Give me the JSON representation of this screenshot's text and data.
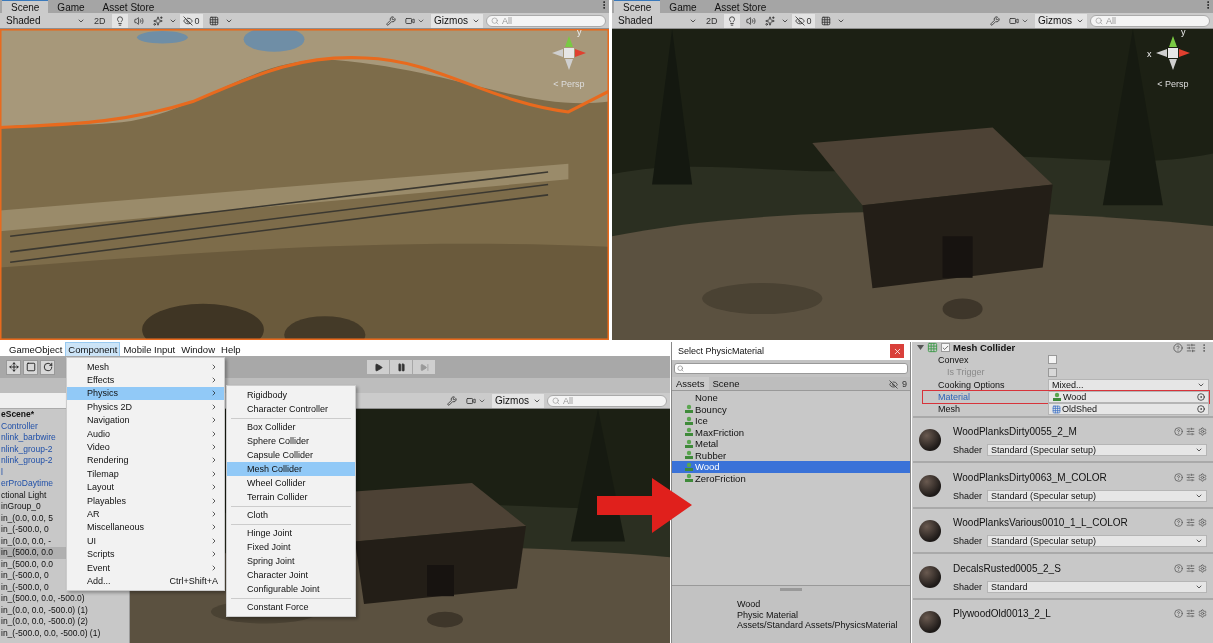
{
  "scene_views": [
    {
      "tabs": [
        {
          "label": "Scene",
          "selected": true
        },
        {
          "label": "Game",
          "selected": false
        },
        {
          "label": "Asset Store",
          "selected": false
        }
      ],
      "shading": "Shaded",
      "mode_2d": "2D",
      "hidden_count": "0",
      "gizmos": "Gizmos",
      "search": {
        "placeholder": "All"
      },
      "persp": "< Persp",
      "axis_labels": [
        "y"
      ]
    },
    {
      "tabs": [
        {
          "label": "Scene",
          "selected": true
        },
        {
          "label": "Game",
          "selected": false
        },
        {
          "label": "Asset Store",
          "selected": false
        }
      ],
      "shading": "Shaded",
      "mode_2d": "2D",
      "hidden_count": "0",
      "gizmos": "Gizmos",
      "search": {
        "placeholder": "All"
      },
      "persp": "< Persp",
      "axis_labels": [
        "y",
        "x"
      ]
    }
  ],
  "editor": {
    "menubar": [
      {
        "label": "GameObject",
        "selected": false
      },
      {
        "label": "Component",
        "selected": true
      },
      {
        "label": "Mobile Input",
        "selected": false
      },
      {
        "label": "Window",
        "selected": false
      },
      {
        "label": "Help",
        "selected": false
      }
    ],
    "play_controls": [
      {
        "kind": "play",
        "disabled": false
      },
      {
        "kind": "pause",
        "disabled": false
      },
      {
        "kind": "step",
        "disabled": true
      }
    ],
    "hierarchy": [
      {
        "label": "eScene*",
        "kind": "scene",
        "selected": false
      },
      {
        "label": "Controller",
        "kind": "prefab",
        "selected": false
      },
      {
        "label": "nlink_barbwire",
        "kind": "prefab",
        "selected": false
      },
      {
        "label": "nlink_group-2",
        "kind": "prefab",
        "selected": false
      },
      {
        "label": "nlink_group-2",
        "kind": "prefab",
        "selected": false
      },
      {
        "label": "l",
        "kind": "prefab",
        "selected": false
      },
      {
        "label": "erProDaytime",
        "kind": "prefab",
        "selected": false
      },
      {
        "label": "ctional Light",
        "kind": "object",
        "selected": false
      },
      {
        "label": "inGroup_0",
        "kind": "object",
        "selected": false
      },
      {
        "label": "in_(0.0, 0.0, 5",
        "kind": "object",
        "selected": false
      },
      {
        "label": "in_(-500.0, 0",
        "kind": "object",
        "selected": false
      },
      {
        "label": "in_(0.0, 0.0, -",
        "kind": "object",
        "selected": false
      },
      {
        "label": "in_(500.0, 0.0",
        "kind": "object",
        "selected": true
      },
      {
        "label": "in_(500.0, 0.0",
        "kind": "object",
        "selected": false
      },
      {
        "label": "in_(-500.0, 0",
        "kind": "object",
        "selected": false
      },
      {
        "label": "in_(-500.0, 0",
        "kind": "object",
        "selected": false
      },
      {
        "label": "in_(500.0, 0.0, -500.0)",
        "kind": "object",
        "selected": false
      },
      {
        "label": "in_(0.0, 0.0, -500.0) (1)",
        "kind": "object",
        "selected": false
      },
      {
        "label": "in_(0.0, 0.0, -500.0) (2)",
        "kind": "object",
        "selected": false
      },
      {
        "label": "in_(-500.0, 0.0, -500.0) (1)",
        "kind": "object",
        "selected": false
      }
    ],
    "scene_toolbar": {
      "gizmos": "Gizmos",
      "search": {
        "placeholder": "All"
      }
    },
    "component_menu": [
      {
        "label": "Mesh",
        "submenu": true,
        "selected": false
      },
      {
        "label": "Effects",
        "submenu": true,
        "selected": false
      },
      {
        "label": "Physics",
        "submenu": true,
        "selected": true
      },
      {
        "label": "Physics 2D",
        "submenu": true,
        "selected": false
      },
      {
        "label": "Navigation",
        "submenu": true,
        "selected": false
      },
      {
        "label": "Audio",
        "submenu": true,
        "selected": false
      },
      {
        "label": "Video",
        "submenu": true,
        "selected": false
      },
      {
        "label": "Rendering",
        "submenu": true,
        "selected": false
      },
      {
        "label": "Tilemap",
        "submenu": true,
        "selected": false
      },
      {
        "label": "Layout",
        "submenu": true,
        "selected": false
      },
      {
        "label": "Playables",
        "submenu": true,
        "selected": false
      },
      {
        "label": "AR",
        "submenu": true,
        "selected": false
      },
      {
        "label": "Miscellaneous",
        "submenu": true,
        "selected": false
      },
      {
        "label": "UI",
        "submenu": true,
        "selected": false
      },
      {
        "label": "Scripts",
        "submenu": true,
        "selected": false
      },
      {
        "label": "Event",
        "submenu": true,
        "selected": false
      },
      {
        "label": "Add...",
        "submenu": false,
        "shortcut": "Ctrl+Shift+A",
        "selected": false
      }
    ],
    "physics_submenu": [
      [
        {
          "label": "Rigidbody",
          "selected": false
        },
        {
          "label": "Character Controller",
          "selected": false
        }
      ],
      [
        {
          "label": "Box Collider",
          "selected": false
        },
        {
          "label": "Sphere Collider",
          "selected": false
        },
        {
          "label": "Capsule Collider",
          "selected": false
        },
        {
          "label": "Mesh Collider",
          "selected": true
        },
        {
          "label": "Wheel Collider",
          "selected": false
        },
        {
          "label": "Terrain Collider",
          "selected": false
        }
      ],
      [
        {
          "label": "Cloth",
          "selected": false
        }
      ],
      [
        {
          "label": "Hinge Joint",
          "selected": false
        },
        {
          "label": "Fixed Joint",
          "selected": false
        },
        {
          "label": "Spring Joint",
          "selected": false
        },
        {
          "label": "Character Joint",
          "selected": false
        },
        {
          "label": "Configurable Joint",
          "selected": false
        }
      ],
      [
        {
          "label": "Constant Force",
          "selected": false
        }
      ]
    ]
  },
  "picker": {
    "title": "Select PhysicMaterial",
    "tabs": [
      {
        "label": "Assets",
        "selected": true
      },
      {
        "label": "Scene",
        "selected": false
      }
    ],
    "hidden_count": "9",
    "items": [
      {
        "label": "None",
        "kind": "none",
        "selected": false
      },
      {
        "label": "Bouncy",
        "kind": "asset",
        "selected": false
      },
      {
        "label": "Ice",
        "kind": "asset",
        "selected": false
      },
      {
        "label": "MaxFriction",
        "kind": "asset",
        "selected": false
      },
      {
        "label": "Metal",
        "kind": "asset",
        "selected": false
      },
      {
        "label": "Rubber",
        "kind": "asset",
        "selected": false
      },
      {
        "label": "Wood",
        "kind": "asset",
        "selected": true
      },
      {
        "label": "ZeroFriction",
        "kind": "asset",
        "selected": false
      }
    ],
    "preview": {
      "name": "Wood",
      "type": "Physic Material",
      "path": "Assets/Standard Assets/PhysicsMaterial"
    }
  },
  "inspector": {
    "component": {
      "title": "Mesh Collider",
      "enabled": true,
      "expanded": true
    },
    "properties": [
      {
        "label": "Convex",
        "kind": "checkbox",
        "checked": false,
        "disabled": false,
        "highlighted": false,
        "modified": false
      },
      {
        "label": "Is Trigger",
        "kind": "checkbox",
        "checked": false,
        "disabled": true,
        "highlighted": false,
        "modified": false
      },
      {
        "label": "Cooking Options",
        "kind": "dropdown",
        "value": "Mixed...",
        "disabled": false,
        "highlighted": false,
        "modified": false
      },
      {
        "label": "Material",
        "kind": "material_object",
        "value": "Wood",
        "disabled": false,
        "highlighted": true,
        "modified": true
      },
      {
        "label": "Mesh",
        "kind": "mesh_object",
        "value": "OldShed",
        "disabled": false,
        "highlighted": false,
        "modified": false
      }
    ],
    "materials": [
      {
        "name": "WoodPlanksDirty0055_2_M",
        "shader_label": "Shader",
        "shader": "Standard (Specular setup)"
      },
      {
        "name": "WoodPlanksDirty0063_M_COLOR",
        "shader_label": "Shader",
        "shader": "Standard (Specular setup)"
      },
      {
        "name": "WoodPlanksVarious0010_1_L_COLOR",
        "shader_label": "Shader",
        "shader": "Standard (Specular setup)"
      },
      {
        "name": "DecalsRusted0005_2_S",
        "shader_label": "Shader",
        "shader": "Standard"
      },
      {
        "name": "PlywoodOld0013_2_L"
      }
    ]
  }
}
